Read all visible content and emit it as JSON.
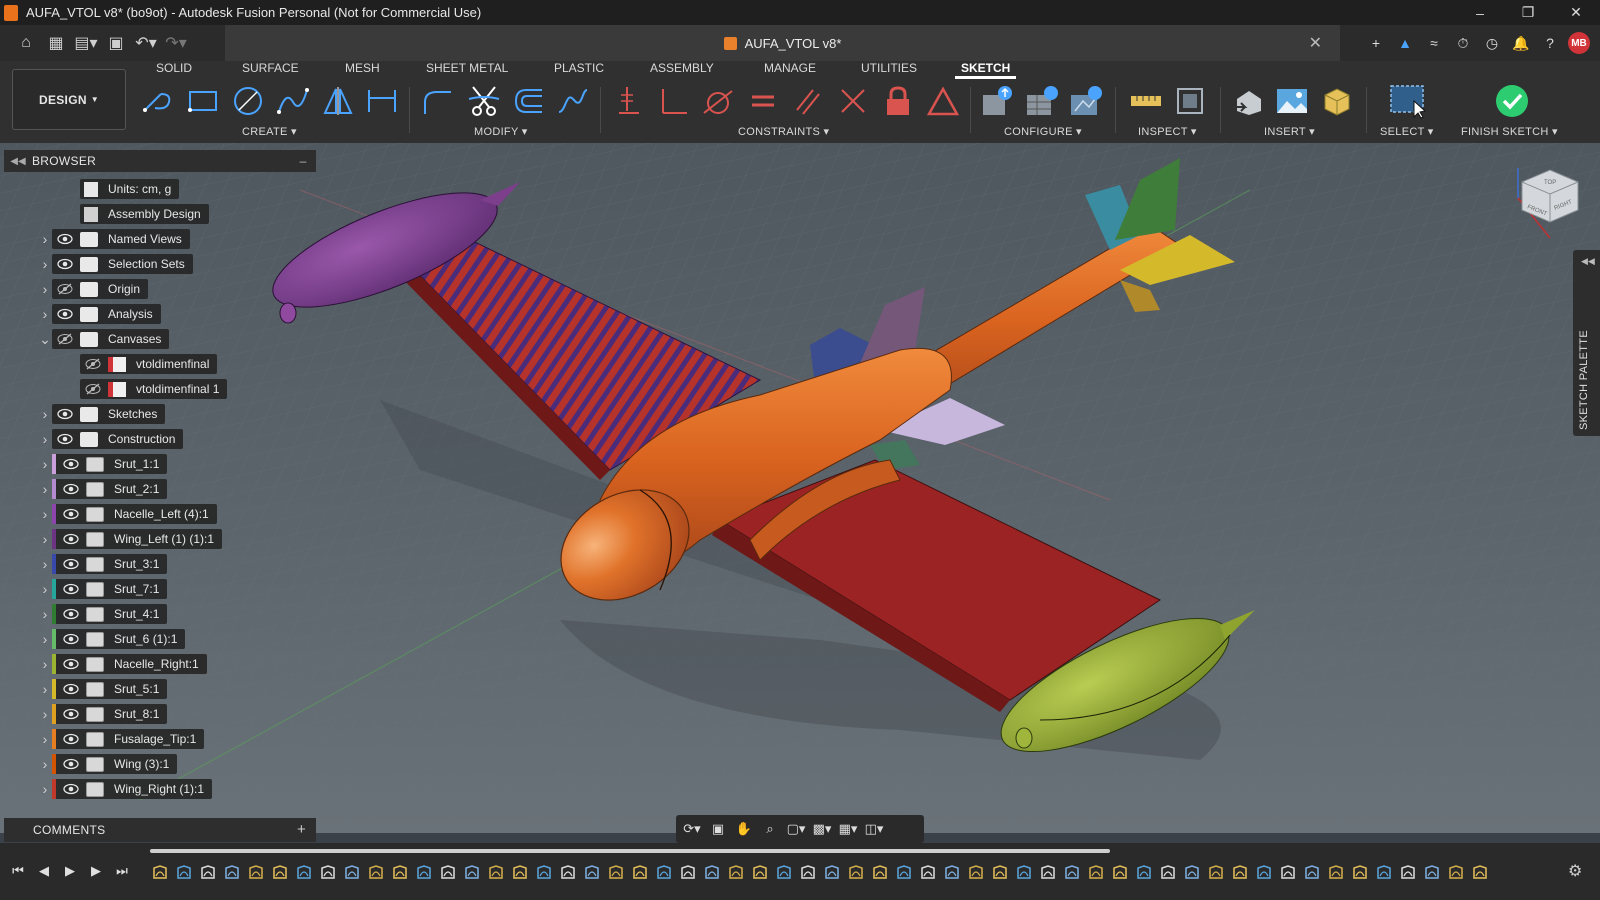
{
  "window": {
    "title": "AUFA_VTOL v8* (bo9ot) - Autodesk Fusion Personal (Not for Commercial Use)",
    "minimize_icon": "minimize-icon",
    "maximize_icon": "maximize-icon",
    "close_icon": "close-icon"
  },
  "document": {
    "tab_title": "AUFA_VTOL v8*"
  },
  "user": {
    "initials": "MB"
  },
  "toolbar": {
    "workspace": "DESIGN",
    "tabs": [
      "SOLID",
      "SURFACE",
      "MESH",
      "SHEET METAL",
      "PLASTIC",
      "ASSEMBLY",
      "MANAGE",
      "UTILITIES",
      "SKETCH"
    ],
    "active_tab": "SKETCH",
    "groups": {
      "create": "CREATE",
      "modify": "MODIFY",
      "constraints": "CONSTRAINTS",
      "configure": "CONFIGURE",
      "inspect": "INSPECT",
      "insert": "INSERT",
      "select": "SELECT",
      "finish": "FINISH SKETCH"
    }
  },
  "browser": {
    "title": "BROWSER",
    "items": [
      {
        "label": "Units: cm, g",
        "type": "doc"
      },
      {
        "label": "Assembly Design",
        "type": "assembly"
      },
      {
        "label": "Named Views",
        "type": "folder"
      },
      {
        "label": "Selection Sets",
        "type": "folder"
      },
      {
        "label": "Origin",
        "type": "folder",
        "hidden": true
      },
      {
        "label": "Analysis",
        "type": "folder"
      },
      {
        "label": "Canvases",
        "type": "folder",
        "hidden": true,
        "expanded": true
      },
      {
        "label": "vtoldimenfinal",
        "type": "canvas",
        "hidden": true
      },
      {
        "label": "vtoldimenfinal 1",
        "type": "canvas",
        "hidden": true
      },
      {
        "label": "Sketches",
        "type": "folder"
      },
      {
        "label": "Construction",
        "type": "folder"
      },
      {
        "label": "Srut_1:1",
        "type": "body",
        "color": "#c9a0dc"
      },
      {
        "label": "Srut_2:1",
        "type": "body",
        "color": "#b48ad0"
      },
      {
        "label": "Nacelle_Left (4):1",
        "type": "body",
        "color": "#8e44ad"
      },
      {
        "label": "Wing_Left (1) (1):1",
        "type": "body",
        "color": "#6c3483"
      },
      {
        "label": "Srut_3:1",
        "type": "body",
        "color": "#3949ab"
      },
      {
        "label": "Srut_7:1",
        "type": "body",
        "color": "#26a69a"
      },
      {
        "label": "Srut_4:1",
        "type": "body",
        "color": "#2e7d32"
      },
      {
        "label": "Srut_6 (1):1",
        "type": "body",
        "color": "#66bb6a"
      },
      {
        "label": "Nacelle_Right:1",
        "type": "body",
        "color": "#9bb432"
      },
      {
        "label": "Srut_5:1",
        "type": "body",
        "color": "#d4b92a"
      },
      {
        "label": "Srut_8:1",
        "type": "body",
        "color": "#e0a020"
      },
      {
        "label": "Fusalage_Tip:1",
        "type": "body",
        "color": "#e67e22"
      },
      {
        "label": "Wing (3):1",
        "type": "body",
        "color": "#d35400"
      },
      {
        "label": "Wing_Right (1):1",
        "type": "body",
        "color": "#c0392b"
      }
    ]
  },
  "comments": {
    "title": "COMMENTS"
  },
  "sketch_palette": {
    "title": "SKETCH PALETTE"
  },
  "viewcube": {
    "front": "FRONT",
    "right": "RIGHT",
    "top": "TOP"
  },
  "colors": {
    "fuselage": "#d9631f",
    "wing_right": "#9b2323",
    "wing_left_stripes": "#4a2c7a",
    "nacelle_left": "#7d3e8c",
    "nacelle_right": "#8ea42f",
    "accent_finish": "#2ecc71"
  }
}
